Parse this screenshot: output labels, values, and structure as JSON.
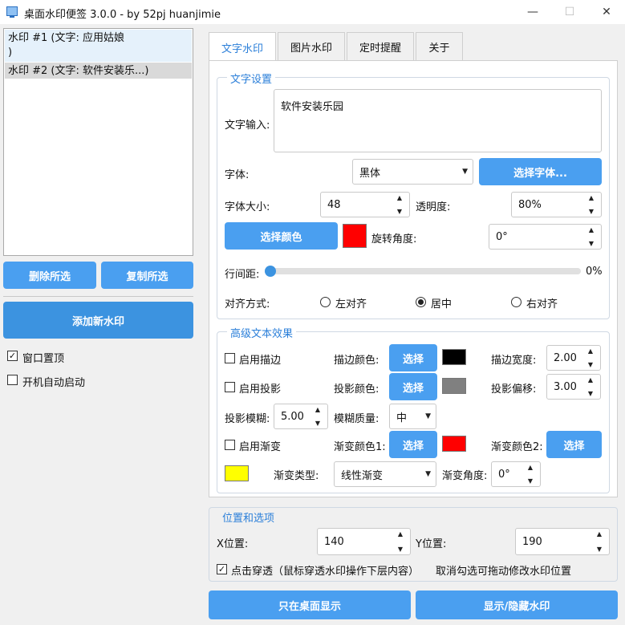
{
  "window": {
    "title": "桌面水印便签 3.0.0 - by 52pj huanjimie",
    "minimize_glyph": "—",
    "maximize_glyph": "☐",
    "close_glyph": "✕"
  },
  "watermark_list": {
    "items": [
      {
        "label_line1": "水印 #1 (文字: 应用姑娘",
        "label_line2": ")"
      },
      {
        "label_line1": "水印 #2 (文字: 软件安装乐...)"
      }
    ]
  },
  "left_buttons": {
    "delete_selected": "删除所选",
    "copy_selected": "复制所选",
    "add_new": "添加新水印"
  },
  "left_options": {
    "window_on_top": {
      "label": "窗口置顶",
      "checked": true
    },
    "auto_start": {
      "label": "开机自动启动",
      "checked": false
    }
  },
  "tabs": [
    "文字水印",
    "图片水印",
    "定时提醒",
    "关于"
  ],
  "text_settings": {
    "group_title": "文字设置",
    "text_input_label": "文字输入:",
    "text_input_value": "软件安装乐园",
    "font_label": "字体:",
    "font_value": "黑体",
    "choose_font_button": "选择字体...",
    "font_size_label": "字体大小:",
    "font_size_value": "48",
    "opacity_label": "透明度:",
    "opacity_value": "80%",
    "choose_color_button": "选择颜色",
    "text_color": "#ff0000",
    "rotation_label": "旋转角度:",
    "rotation_value": "0°",
    "line_spacing_label": "行间距:",
    "line_spacing_value": "0%",
    "line_spacing_fraction": 0,
    "align_label": "对齐方式:",
    "align_options": [
      "左对齐",
      "居中",
      "右对齐"
    ],
    "align_selected": "居中"
  },
  "advanced": {
    "group_title": "高级文本效果",
    "enable_stroke": "启用描边",
    "stroke_color_label": "描边颜色:",
    "stroke_color": "#000000",
    "stroke_width_label": "描边宽度:",
    "stroke_width_value": "2.00",
    "enable_shadow": "启用投影",
    "shadow_color_label": "投影颜色:",
    "shadow_color": "#808080",
    "shadow_offset_label": "投影偏移:",
    "shadow_offset_value": "3.00",
    "shadow_blur_label": "投影模糊:",
    "shadow_blur_value": "5.00",
    "blur_quality_label": "模糊质量:",
    "blur_quality_value": "中",
    "enable_gradient": "启用渐变",
    "gradient_color1_label": "渐变颜色1:",
    "gradient_color1": "#ff0000",
    "gradient_color2_label": "渐变颜色2:",
    "gradient_color2": "#ffff00",
    "gradient_type_label": "渐变类型:",
    "gradient_type_value": "线性渐变",
    "gradient_angle_label": "渐变角度:",
    "gradient_angle_value": "0°",
    "choose_button": "选择"
  },
  "position": {
    "group_title": "位置和选项",
    "x_label": "X位置:",
    "x_value": "140",
    "y_label": "Y位置:",
    "y_value": "190",
    "click_through_label": "点击穿透（鼠标穿透水印操作下层内容）",
    "click_through_checked": true,
    "hint": "取消勾选可拖动修改水印位置"
  },
  "bottom_buttons": {
    "desktop_only": "只在桌面显示",
    "toggle_show": "显示/隐藏水印"
  },
  "colors": {
    "accent": "#4a9ff0",
    "accent_text": "#2b7fd9"
  }
}
